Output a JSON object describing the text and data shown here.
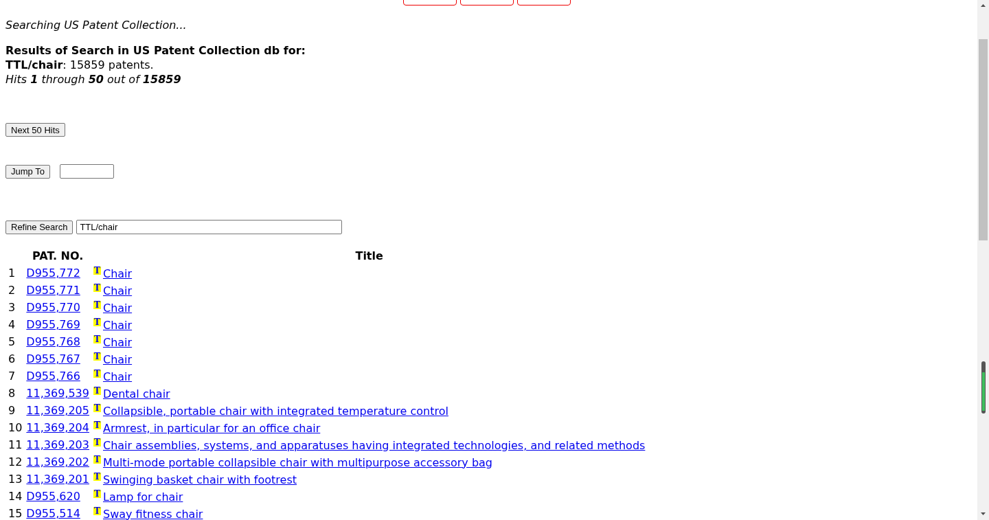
{
  "status": "Searching US Patent Collection...",
  "results_heading": "Results of Search in US Patent Collection db for:",
  "query_line": "**TTL/chair**: 15859 patents.",
  "hits_line": "Hits **1** through **50** out of **15859**",
  "next_button": "Next 50 Hits",
  "jump_button": "Jump To",
  "refine_button": "Refine Search",
  "refine_value": "TTL/chair",
  "table": {
    "columns": [
      "PAT. NO.",
      "Title"
    ],
    "rows": [
      {
        "num": "1",
        "pat_no": "D955,772",
        "icon": "T",
        "title": "Chair"
      },
      {
        "num": "2",
        "pat_no": "D955,771",
        "icon": "T",
        "title": "Chair"
      },
      {
        "num": "3",
        "pat_no": "D955,770",
        "icon": "T",
        "title": "Chair"
      },
      {
        "num": "4",
        "pat_no": "D955,769",
        "icon": "T",
        "title": "Chair"
      },
      {
        "num": "5",
        "pat_no": "D955,768",
        "icon": "T",
        "title": "Chair"
      },
      {
        "num": "6",
        "pat_no": "D955,767",
        "icon": "T",
        "title": "Chair"
      },
      {
        "num": "7",
        "pat_no": "D955,766",
        "icon": "T",
        "title": "Chair"
      },
      {
        "num": "8",
        "pat_no": "11,369,539",
        "icon": "T",
        "title": "Dental chair"
      },
      {
        "num": "9",
        "pat_no": "11,369,205",
        "icon": "T",
        "title": "Collapsible, portable chair with integrated temperature control"
      },
      {
        "num": "10",
        "pat_no": "11,369,204",
        "icon": "T",
        "title": "Armrest, in particular for an office chair"
      },
      {
        "num": "11",
        "pat_no": "11,369,203",
        "icon": "T",
        "title": "Chair assemblies, systems, and apparatuses having integrated technologies, and related methods"
      },
      {
        "num": "12",
        "pat_no": "11,369,202",
        "icon": "T",
        "title": "Multi-mode portable collapsible chair with multipurpose accessory bag"
      },
      {
        "num": "13",
        "pat_no": "11,369,201",
        "icon": "T",
        "title": "Swinging basket chair with footrest"
      },
      {
        "num": "14",
        "pat_no": "D955,620",
        "icon": "T",
        "title": "Lamp for chair"
      },
      {
        "num": "15",
        "pat_no": "D955,514",
        "icon": "T",
        "title": "Sway fitness chair"
      }
    ]
  }
}
